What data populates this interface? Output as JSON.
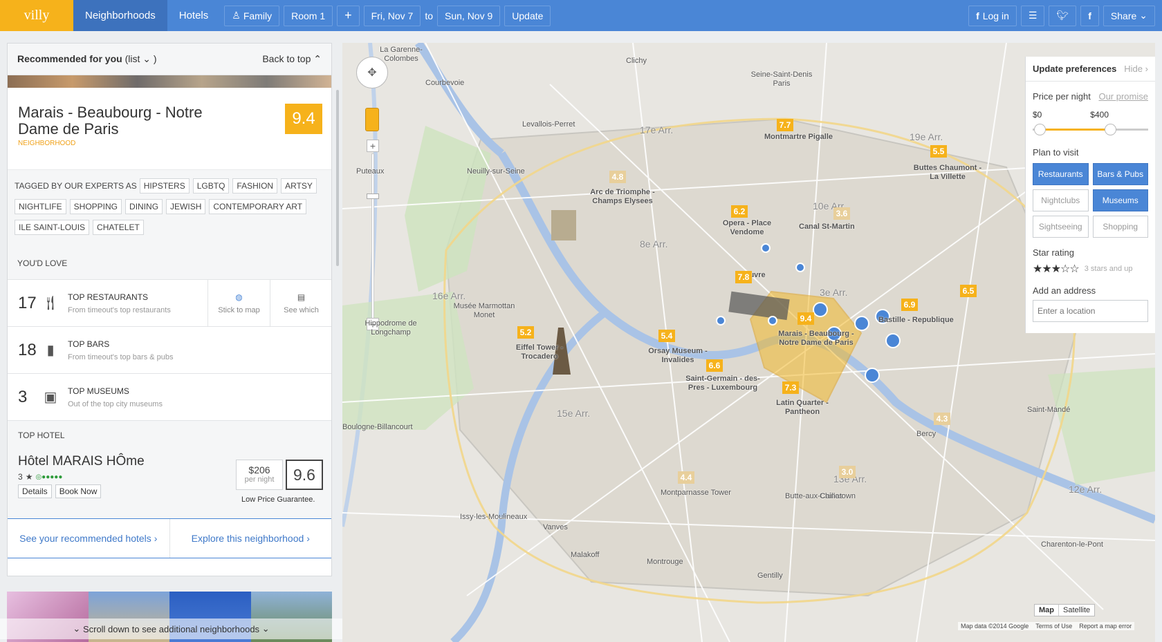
{
  "nav": {
    "logo": "villy",
    "tabs": [
      "Neighborhoods",
      "Hotels"
    ],
    "family": "Family",
    "room": "Room 1",
    "plus": "+",
    "date_from": "Fri, Nov 7",
    "to": "to",
    "date_to": "Sun, Nov 9",
    "update": "Update",
    "login": "Log in",
    "share": "Share"
  },
  "panel": {
    "recommended": "Recommended for you",
    "list": "(list",
    "back_to_top": "Back to top"
  },
  "neighborhood": {
    "name": "Marais - Beaubourg - Notre Dame de Paris",
    "type": "NEIGHBORHOOD",
    "score": "9.4",
    "tagged_label": "TAGGED BY OUR EXPERTS AS",
    "tags": [
      "HIPSTERS",
      "LGBTQ",
      "FASHION",
      "ARTSY",
      "NIGHTLIFE",
      "SHOPPING",
      "DINING",
      "JEWISH",
      "CONTEMPORARY ART",
      "ILE SAINT-LOUIS",
      "CHATELET"
    ],
    "youd_love": "YOU'D LOVE",
    "categories": [
      {
        "count": "17",
        "title": "TOP RESTAURANTS",
        "sub": "From timeout's top restaurants",
        "icon": "fork-knife-icon"
      },
      {
        "count": "18",
        "title": "TOP BARS",
        "sub": "From timeout's top bars & pubs",
        "icon": "beer-icon"
      },
      {
        "count": "3",
        "title": "TOP MUSEUMS",
        "sub": "Out of the top city museums",
        "icon": "picture-icon"
      }
    ],
    "stick_to_map": "Stick to map",
    "see_which": "See which"
  },
  "top_hotel": {
    "label": "TOP HOTEL",
    "name": "Hôtel MARAIS HÔme",
    "stars": "3",
    "details": "Details",
    "book": "Book Now",
    "price": "$206",
    "per_night": "per night",
    "score": "9.6",
    "guarantee": "Low Price Guarantee."
  },
  "links": {
    "hotels": "See your recommended hotels",
    "explore": "Explore this neighborhood"
  },
  "scroll_more": "Scroll down to see additional neighborhoods",
  "prefs": {
    "title": "Update preferences",
    "hide": "Hide",
    "price_label": "Price per night",
    "our_promise": "Our promise",
    "min": "$0",
    "max": "$400",
    "plan": "Plan to visit",
    "options": [
      {
        "label": "Restaurants",
        "on": true
      },
      {
        "label": "Bars & Pubs",
        "on": true
      },
      {
        "label": "Nightclubs",
        "on": false
      },
      {
        "label": "Museums",
        "on": true
      },
      {
        "label": "Sightseeing",
        "on": false
      },
      {
        "label": "Shopping",
        "on": false
      }
    ],
    "star_label": "Star rating",
    "star_text": "3 stars and up",
    "address_label": "Add an address",
    "address_placeholder": "Enter a location"
  },
  "map": {
    "labels": [
      "La Garenne-Colombes",
      "Courbevoie",
      "Clichy",
      "Levallois-Perret",
      "Neuilly-sur-Seine",
      "Seine-Saint-Denis Paris",
      "Montmartre Pigalle",
      "Buttes Chaumont - La Villette",
      "Arc de Triomphe - Champs Elysees",
      "Opera - Place Vendome",
      "Canal St-Martin",
      "Louvre",
      "Marais - Beaubourg - Notre Dame de Paris",
      "Bastille - Republique",
      "Eiffel Tower - Trocadero",
      "Orsay Museum - Invalides",
      "Saint-Germain - des-Pres - Luxembourg",
      "Latin Quarter - Pantheon",
      "Musée Marmottan Monet",
      "Hippodrome de Longchamp",
      "Boulogne-Billancourt",
      "Issy-les-Moulineaux",
      "Vanves",
      "Malakoff",
      "Montrouge",
      "Gentilly",
      "Montparnasse Tower",
      "Bercy",
      "Butte-aux-Cailles",
      "Chinatown",
      "Charenton-le-Pont",
      "Saint-Mandé",
      "Puteaux",
      "17e Arr.",
      "8e Arr.",
      "16e Arr.",
      "15e Arr.",
      "13e Arr.",
      "12e Arr.",
      "19e Arr.",
      "10e Arr.",
      "3e Arr."
    ],
    "scores": [
      {
        "v": "7.7",
        "c": "#f6b21b"
      },
      {
        "v": "5.5",
        "c": "#f6b21b"
      },
      {
        "v": "4.8",
        "c": "#e8cf9b"
      },
      {
        "v": "6.2",
        "c": "#f6b21b"
      },
      {
        "v": "3.6",
        "c": "#e8cf9b"
      },
      {
        "v": "7.8",
        "c": "#f6b21b"
      },
      {
        "v": "9.4",
        "c": "#f6b21b"
      },
      {
        "v": "6.9",
        "c": "#f6b21b"
      },
      {
        "v": "6.5",
        "c": "#f6b21b"
      },
      {
        "v": "5.2",
        "c": "#f6b21b"
      },
      {
        "v": "5.4",
        "c": "#f6b21b"
      },
      {
        "v": "6.6",
        "c": "#f6b21b"
      },
      {
        "v": "7.3",
        "c": "#f6b21b"
      },
      {
        "v": "4.4",
        "c": "#e8cf9b"
      },
      {
        "v": "3.0",
        "c": "#e8cf9b"
      },
      {
        "v": "4.3",
        "c": "#e8cf9b"
      }
    ],
    "map_btn": "Map",
    "sat_btn": "Satellite",
    "attribution": "Map data ©2014 Google",
    "terms": "Terms of Use",
    "report": "Report a map error"
  }
}
